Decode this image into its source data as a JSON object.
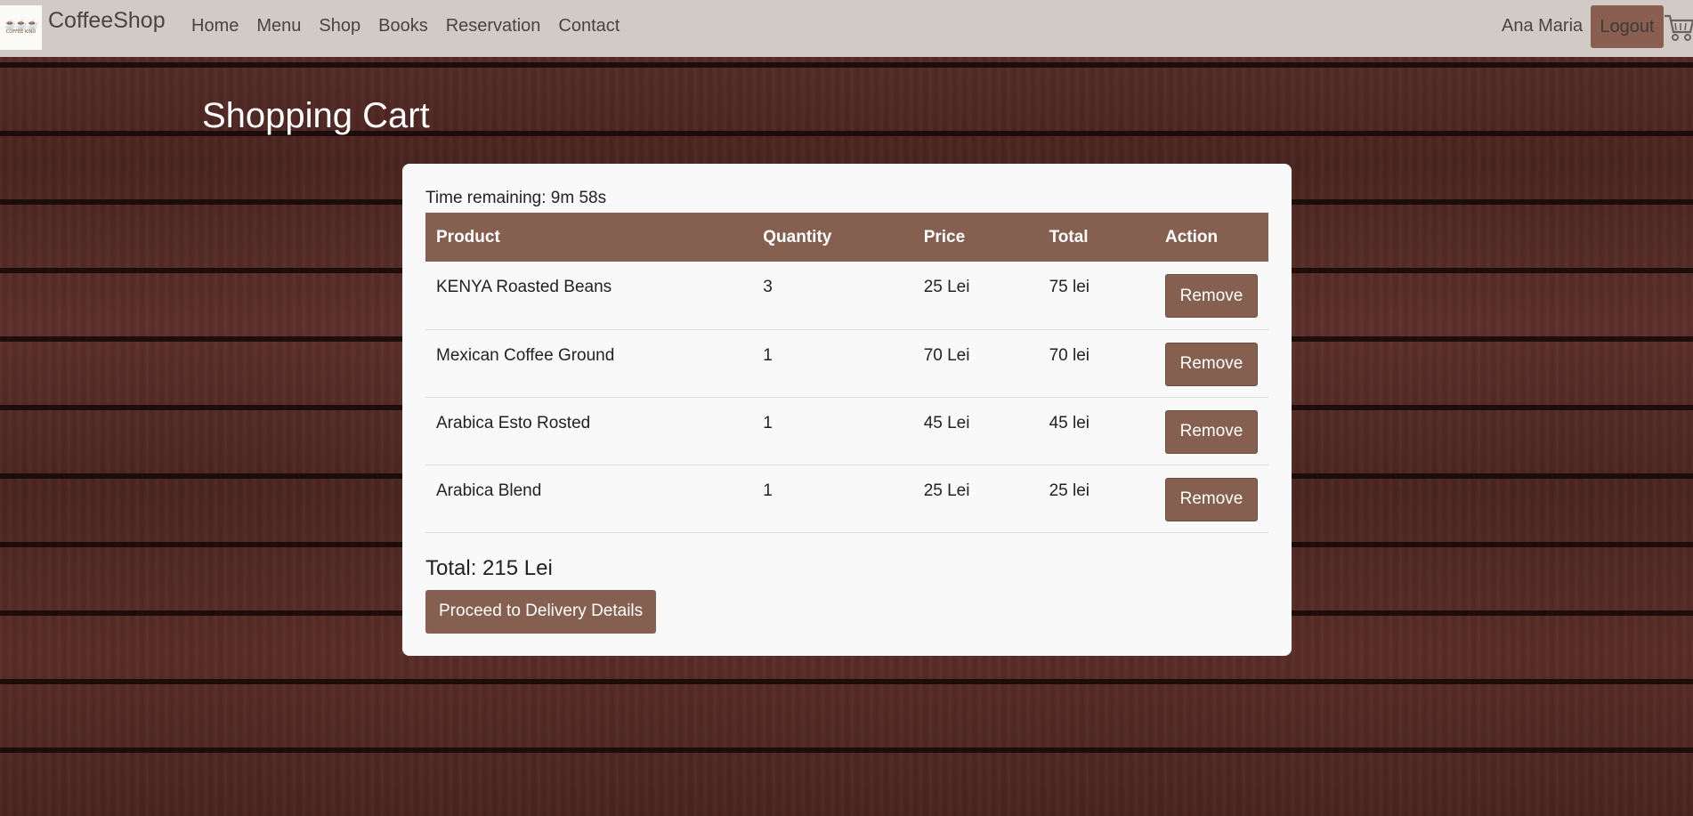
{
  "nav": {
    "brand": "CoffeeShop",
    "logo_text": "COFFEE KIND",
    "links": [
      "Home",
      "Menu",
      "Shop",
      "Books",
      "Reservation",
      "Contact"
    ],
    "user_name": "Ana Maria",
    "logout_label": "Logout"
  },
  "page": {
    "title": "Shopping Cart"
  },
  "cart": {
    "timer": "Time remaining: 9m 58s",
    "headers": [
      "Product",
      "Quantity",
      "Price",
      "Total",
      "Action"
    ],
    "rows": [
      {
        "product": "KENYA Roasted Beans",
        "quantity": "3",
        "price": "25 Lei",
        "total": "75 lei",
        "action": "Remove"
      },
      {
        "product": "Mexican Coffee Ground",
        "quantity": "1",
        "price": "70 Lei",
        "total": "70 lei",
        "action": "Remove"
      },
      {
        "product": "Arabica Esto Rosted",
        "quantity": "1",
        "price": "45 Lei",
        "total": "45 lei",
        "action": "Remove"
      },
      {
        "product": "Arabica Blend",
        "quantity": "1",
        "price": "25 Lei",
        "total": "25 lei",
        "action": "Remove"
      }
    ],
    "total_text": "Total: 215 Lei",
    "proceed_label": "Proceed to Delivery Details"
  },
  "colors": {
    "accent": "#855f50",
    "navbar_bg": "#dcd6d1",
    "card_bg": "#f9f9f9"
  },
  "icons": {
    "cart": "shopping-cart-icon",
    "logo": "coffee-logo-icon"
  }
}
